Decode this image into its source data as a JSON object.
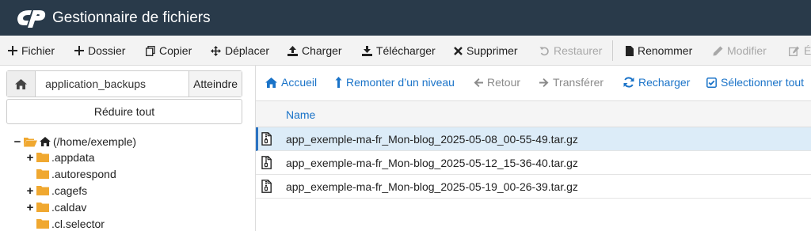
{
  "header": {
    "title": "Gestionnaire de fichiers"
  },
  "toolbar": {
    "buttons": [
      {
        "label": "Fichier",
        "icon": "plus-icon"
      },
      {
        "label": "Dossier",
        "icon": "plus-icon"
      },
      {
        "label": "Copier",
        "icon": "copy-icon"
      },
      {
        "label": "Déplacer",
        "icon": "move-icon"
      },
      {
        "label": "Charger",
        "icon": "upload-icon"
      },
      {
        "label": "Télécharger",
        "icon": "download-icon"
      },
      {
        "label": "Supprimer",
        "icon": "x-icon"
      },
      {
        "label": "Restaurer",
        "icon": "undo-icon",
        "disabled": true
      },
      {
        "label": "Renommer",
        "icon": "file-icon"
      },
      {
        "label": "Modifier",
        "icon": "pencil-icon",
        "disabled": true
      },
      {
        "label": "É",
        "icon": "edit-icon",
        "disabled": true
      }
    ]
  },
  "left": {
    "path_value": "application_backups",
    "go_label": "Atteindre",
    "collapse_label": "Réduire tout",
    "tree": [
      {
        "label": "(/home/exemple)",
        "toggle": "−",
        "icon": "open-folder-home-icon"
      },
      {
        "label": ".appdata",
        "toggle": "+"
      },
      {
        "label": ".autorespond",
        "toggle": ""
      },
      {
        "label": ".cagefs",
        "toggle": "+"
      },
      {
        "label": ".caldav",
        "toggle": "+"
      },
      {
        "label": ".cl.selector",
        "toggle": ""
      }
    ]
  },
  "nav": {
    "buttons": [
      {
        "label": "Accueil",
        "icon": "home-icon"
      },
      {
        "label": "Remonter d’un niveau",
        "icon": "level-up-icon"
      },
      {
        "label": "Retour",
        "icon": "arrow-left-icon",
        "disabled": true
      },
      {
        "label": "Transférer",
        "icon": "arrow-right-icon",
        "disabled": true
      },
      {
        "label": "Recharger",
        "icon": "refresh-icon"
      },
      {
        "label": "Sélectionner tout",
        "icon": "check-square-icon"
      }
    ]
  },
  "table": {
    "column_name": "Name",
    "rows": [
      {
        "name": "app_exemple-ma-fr_Mon-blog_2025-05-08_00-55-49.tar.gz",
        "selected": true
      },
      {
        "name": "app_exemple-ma-fr_Mon-blog_2025-05-12_15-36-40.tar.gz",
        "selected": false
      },
      {
        "name": "app_exemple-ma-fr_Mon-blog_2025-05-19_00-26-39.tar.gz",
        "selected": false
      }
    ]
  },
  "colors": {
    "header_bg": "#293a4a",
    "link_blue": "#1a73c8",
    "folder_orange": "#f0a830",
    "selected_row": "#dcecf8"
  }
}
